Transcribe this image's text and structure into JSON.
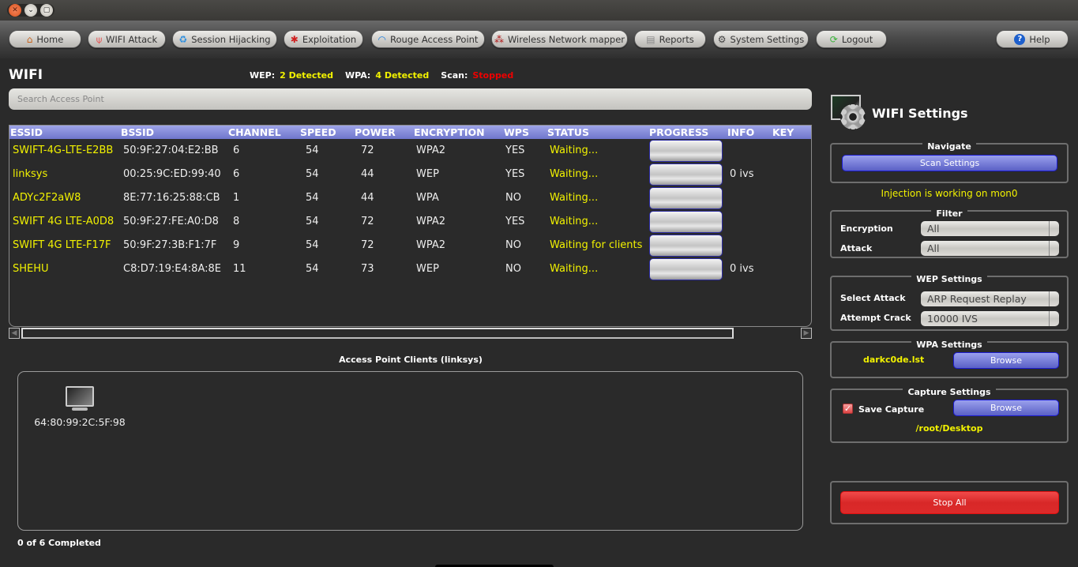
{
  "window": {
    "buttons": [
      "close",
      "minimize",
      "maximize"
    ]
  },
  "toolbar": {
    "items": [
      {
        "label": "Home",
        "icon": "home-icon"
      },
      {
        "label": "WIFI Attack",
        "icon": "antenna-icon"
      },
      {
        "label": "Session Hijacking",
        "icon": "recycle-icon"
      },
      {
        "label": "Exploitation",
        "icon": "bug-icon"
      },
      {
        "label": "Rouge Access Point",
        "icon": "wifi-icon"
      },
      {
        "label": "Wireless Network mapper",
        "icon": "network-nodes-icon"
      },
      {
        "label": "Reports",
        "icon": "report-icon"
      },
      {
        "label": "System Settings",
        "icon": "settings-icon"
      },
      {
        "label": "Logout",
        "icon": "logout-icon"
      }
    ],
    "help": {
      "label": "Help",
      "icon": "help-icon"
    }
  },
  "main": {
    "title": "WIFI",
    "stats": {
      "wep_label": "WEP:",
      "wep_value": "2 Detected",
      "wpa_label": "WPA:",
      "wpa_value": "4 Detected",
      "scan_label": "Scan:",
      "scan_value": "Stopped"
    },
    "search": {
      "placeholder": "Search Access Point",
      "value": ""
    },
    "table": {
      "columns": [
        "ESSID",
        "BSSID",
        "CHANNEL",
        "SPEED",
        "POWER",
        "ENCRYPTION",
        "WPS",
        "STATUS",
        "PROGRESS",
        "INFO",
        "KEY"
      ],
      "rows": [
        {
          "essid": "SWIFT-4G-LTE-E2BB",
          "bssid": "50:9F:27:04:E2:BB",
          "channel": "6",
          "speed": "54",
          "power": "72",
          "encryption": "WPA2",
          "wps": "YES",
          "status": "Waiting...",
          "progress": 0,
          "info": "",
          "key": ""
        },
        {
          "essid": "linksys",
          "bssid": "00:25:9C:ED:99:40",
          "channel": "6",
          "speed": "54",
          "power": "44",
          "encryption": "WEP",
          "wps": "YES",
          "status": "Waiting...",
          "progress": 0,
          "info": "0 ivs",
          "key": ""
        },
        {
          "essid": "ADYc2F2aW8",
          "bssid": "8E:77:16:25:88:CB",
          "channel": "1",
          "speed": "54",
          "power": "44",
          "encryption": "WPA",
          "wps": "NO",
          "status": "Waiting...",
          "progress": 0,
          "info": "",
          "key": ""
        },
        {
          "essid": "SWIFT 4G LTE-A0D8",
          "bssid": "50:9F:27:FE:A0:D8",
          "channel": "8",
          "speed": "54",
          "power": "72",
          "encryption": "WPA2",
          "wps": "YES",
          "status": "Waiting...",
          "progress": 0,
          "info": "",
          "key": ""
        },
        {
          "essid": "SWIFT 4G LTE-F17F",
          "bssid": "50:9F:27:3B:F1:7F",
          "channel": "9",
          "speed": "54",
          "power": "72",
          "encryption": "WPA2",
          "wps": "NO",
          "status": "Waiting for clients",
          "progress": 0,
          "info": "",
          "key": ""
        },
        {
          "essid": "SHEHU",
          "bssid": "C8:D7:19:E4:8A:8E",
          "channel": "11",
          "speed": "54",
          "power": "73",
          "encryption": "WEP",
          "wps": "NO",
          "status": "Waiting...",
          "progress": 0,
          "info": "0 ivs",
          "key": ""
        }
      ]
    },
    "clients": {
      "title": "Access Point Clients (linksys)",
      "items": [
        {
          "mac": "64:80:99:2C:5F:98",
          "icon": "monitor-icon"
        }
      ]
    },
    "completed": "0 of 6 Completed"
  },
  "settings": {
    "title": "WIFI Settings",
    "navigate": {
      "legend": "Navigate",
      "button": "Scan Settings"
    },
    "injection": "Injection is working on mon0",
    "filter": {
      "legend": "Filter",
      "encryption_label": "Encryption",
      "encryption_value": "All",
      "attack_label": "Attack",
      "attack_value": "All"
    },
    "wep": {
      "legend": "WEP Settings",
      "select_attack_label": "Select Attack",
      "select_attack_value": "ARP Request Replay",
      "attempt_crack_label": "Attempt Crack",
      "attempt_crack_value": "10000 IVS"
    },
    "wpa": {
      "legend": "WPA Settings",
      "wordlist": "darkc0de.lst",
      "browse": "Browse"
    },
    "capture": {
      "legend": "Capture Settings",
      "save_label": "Save Capture",
      "save_checked": true,
      "browse": "Browse",
      "path": "/root/Desktop"
    },
    "stop_all": "Stop All"
  },
  "colors": {
    "accent_yellow": "#f2f200",
    "stopped_red": "#e00000",
    "header_blue": "#7f86d8",
    "stop_red": "#dc2a2a"
  }
}
